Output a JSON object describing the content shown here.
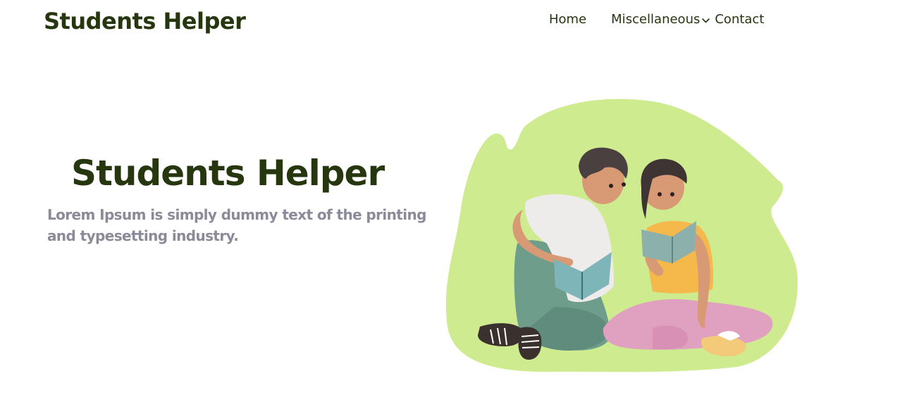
{
  "header": {
    "brand": "Students Helper",
    "nav": {
      "home": "Home",
      "miscellaneous": "Miscellaneous",
      "contact": "Contact"
    }
  },
  "hero": {
    "title": "Students Helper",
    "subtitle": "Lorem Ipsum is simply dummy text of the printing and typesetting industry."
  },
  "colors": {
    "brand_text": "#26360f",
    "subtitle_text": "#8a8a98",
    "blob": "#cfeb8f"
  },
  "icons": {
    "nav_dropdown": "chevron-down-icon"
  }
}
